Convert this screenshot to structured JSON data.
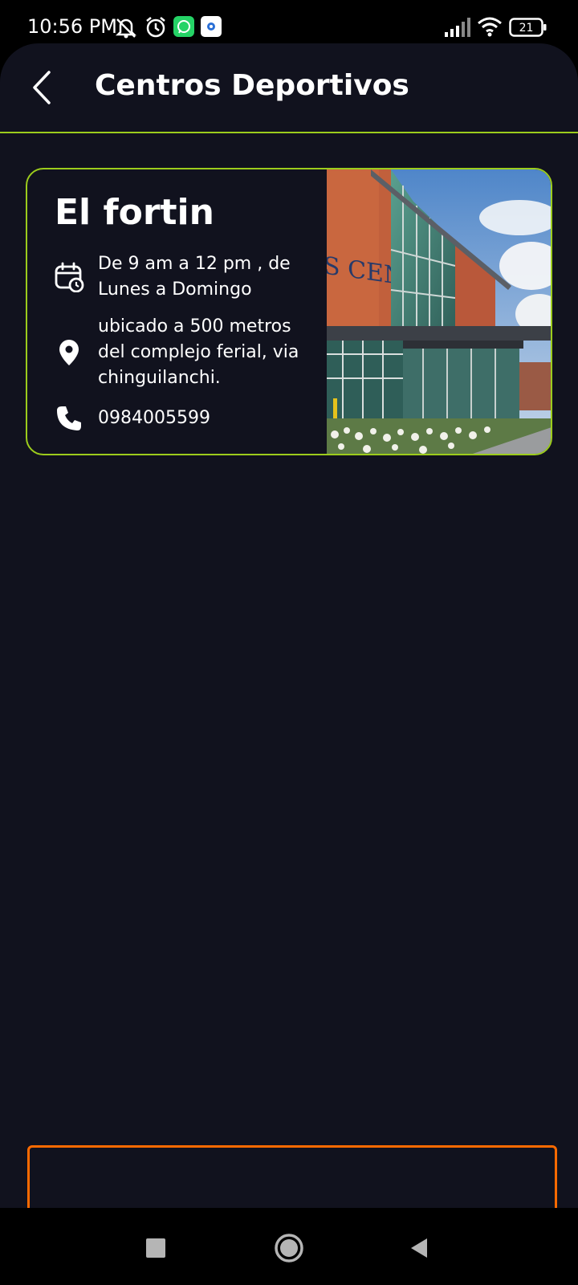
{
  "status_bar": {
    "time": "10:56 PM",
    "battery": "21",
    "icons": [
      "mute-icon",
      "alarm-icon",
      "whatsapp-icon",
      "app-icon",
      "signal-icon",
      "wifi-icon",
      "battery-icon"
    ]
  },
  "header": {
    "title": "Centros Deportivos",
    "back_icon": "chevron-left-icon"
  },
  "center": {
    "name": "El fortin",
    "schedule": "De 9 am a 12 pm , de Lunes a Domingo",
    "address": "ubicado a 500 metros del complejo ferial, via chinguilanchi.",
    "phone": "0984005599",
    "image_sign_text": "S CENTRE"
  },
  "colors": {
    "accent": "#9ccc1c",
    "background": "#11121e",
    "bottom_box_border": "#ff6a00"
  },
  "nav": {
    "buttons": [
      "recents-icon",
      "home-icon",
      "back-icon"
    ]
  }
}
